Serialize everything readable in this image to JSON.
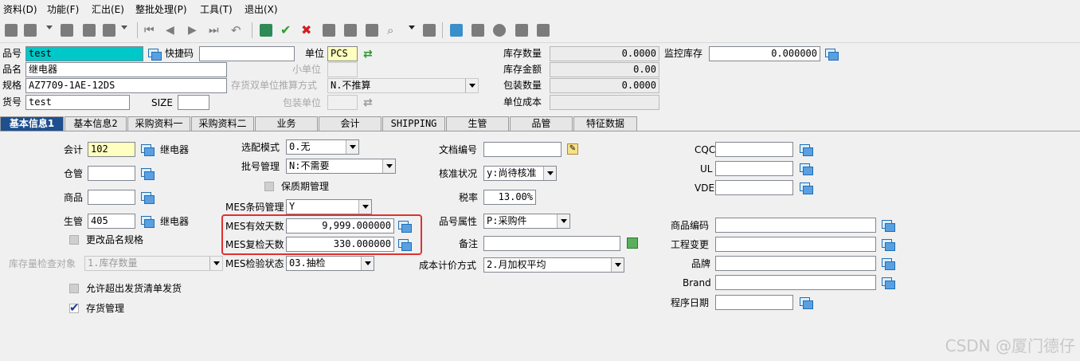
{
  "menu": [
    "资料(D)",
    "功能(F)",
    "汇出(E)",
    "整批处理(P)",
    "工具(T)",
    "退出(X)"
  ],
  "toolbar_icons": [
    "new-icon",
    "copy-icon",
    "dropdown-icon",
    "edit-icon",
    "delete-icon",
    "print-icon",
    "dropdown-icon",
    "first-icon",
    "prev-icon",
    "next-icon",
    "last-icon",
    "undo-icon",
    "calculator-icon",
    "confirm-icon",
    "cancel-icon",
    "tool1-icon",
    "tool2-icon",
    "tool3-icon",
    "search-icon",
    "dropdown-icon",
    "folder-icon",
    "tool4-icon",
    "tool5-icon",
    "tool6-icon",
    "tool7-icon",
    "tool8-icon"
  ],
  "header": {
    "pinhao_label": "品号",
    "pinhao_value": "test",
    "kuaijiema_label": "快捷码",
    "kuaijiema_value": "",
    "danwei_label": "单位",
    "danwei_value": "PCS",
    "kucun_shuliang_label": "库存数量",
    "kucun_shuliang_value": "0.0000",
    "jiankong_label": "监控库存",
    "jiankong_value": "0.000000",
    "pinming_label": "品名",
    "pinming_value": "继电器",
    "xiaodanwei_label": "小单位",
    "xiaodanwei_value": "",
    "kucun_jine_label": "库存金额",
    "kucun_jine_value": "0.00",
    "guige_label": "规格",
    "guige_value": "AZ7709-1AE-12DS",
    "shuangdanwei_label": "存货双单位推算方式",
    "shuangdanwei_value": "N.不推算",
    "baozhuang_shuliang_label": "包装数量",
    "baozhuang_shuliang_value": "0.0000",
    "huohao_label": "货号",
    "huohao_value": "test",
    "size_label": "SIZE",
    "size_value": "",
    "baozhuang_danwei_label": "包装单位",
    "baozhuang_danwei_value": "",
    "danwei_chengben_label": "单位成本",
    "danwei_chengben_value": ""
  },
  "tabs": [
    "基本信息1",
    "基本信息2",
    "采购资料一",
    "采购资料二",
    "业务",
    "会计",
    "SHIPPING",
    "生管",
    "品管",
    "特征数据"
  ],
  "col1": {
    "kuaiji_label": "会计",
    "kuaiji_value": "102",
    "kuaiji_name": "继电器",
    "cangguan_label": "仓管",
    "cangguan_value": "",
    "shangpin_label": "商品",
    "shangpin_value": "",
    "shengguan_label": "生管",
    "shengguan_value": "405",
    "shengguan_name": "继电器",
    "genggai_label": "更改品名规格",
    "jiancha_label": "库存量检查对象",
    "jiancha_value": "1.库存数量",
    "yunxu_label": "允许超出发货清单发货",
    "cunhuo_label": "存货管理"
  },
  "col2": {
    "xuanpei_label": "选配模式",
    "xuanpei_value": "0.无",
    "pihao_label": "批号管理",
    "pihao_value": "N:不需要",
    "baozhiqi_label": "保质期管理",
    "tiaoma_label": "MES条码管理",
    "tiaoma_value": "Y",
    "youxiao_label": "MES有效天数",
    "youxiao_value": "9,999.000000",
    "fujian_label": "MES复检天数",
    "fujian_value": "330.000000",
    "jianyan_label": "MES检验状态",
    "jianyan_value": "03.抽检"
  },
  "col3": {
    "wendang_label": "文档编号",
    "wendang_value": "",
    "hezhun_label": "核准状况",
    "hezhun_value": "y:尚待核准",
    "shuilv_label": "税率",
    "shuilv_value": "13.00%",
    "shuxing_label": "品号属性",
    "shuxing_value": "P:采购件",
    "beizhu_label": "备注",
    "beizhu_value": "",
    "chengben_label": "成本计价方式",
    "chengben_value": "2.月加权平均"
  },
  "col4": {
    "cqc_label": "CQC",
    "cqc_value": "",
    "ul_label": "UL",
    "ul_value": "",
    "vde_label": "VDE",
    "vde_value": "",
    "shangpin_bianma_label": "商品编码",
    "shangpin_bianma_value": "",
    "gongcheng_label": "工程变更",
    "gongcheng_value": "",
    "pinpai_label": "品牌",
    "pinpai_value": "",
    "brand_label": "Brand",
    "brand_value": "",
    "chengxu_label": "程序日期",
    "chengxu_value": ""
  },
  "watermark": "CSDN @厦门德仔",
  "colors": {
    "active_tab": "#1e4f8f",
    "highlight_cyan": "#00c8c8",
    "highlight_yellow": "#ffffc0",
    "annotation_red": "#e03030"
  }
}
